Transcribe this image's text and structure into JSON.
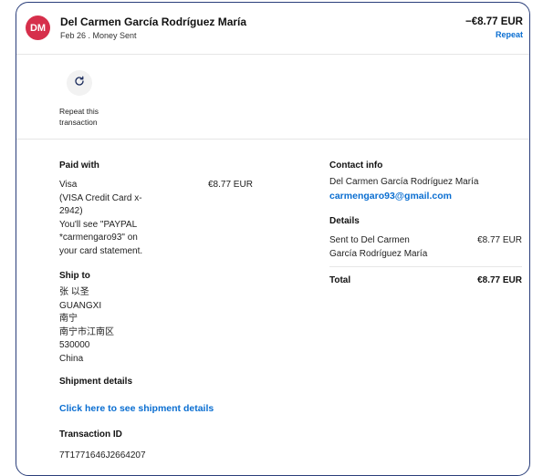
{
  "header": {
    "avatar_initials": "DM",
    "name": "Del Carmen García Rodríguez María",
    "subtitle": "Feb 26 . Money Sent",
    "amount": "−€8.77 EUR",
    "repeat_link": "Repeat"
  },
  "actions": {
    "repeat_label": "Repeat this transaction"
  },
  "paid_with": {
    "label": "Paid with",
    "lines": [
      "Visa",
      "(VISA Credit Card x-",
      "2942)",
      "You'll see \"PAYPAL",
      "*carmengaro93\" on",
      "your card statement."
    ],
    "amount": "€8.77 EUR"
  },
  "ship_to": {
    "label": "Ship to",
    "lines": [
      "张 以圣",
      "GUANGXI",
      "南宁",
      "南宁市江南区",
      "530000",
      "China"
    ]
  },
  "shipment": {
    "label": "Shipment details",
    "link": "Click here to see shipment details"
  },
  "transaction": {
    "label": "Transaction ID",
    "id": "7T1771646J2664207"
  },
  "contact": {
    "label": "Contact info",
    "name": "Del Carmen García Rodríguez María",
    "email": "carmengaro93@gmail.com"
  },
  "details": {
    "label": "Details",
    "sent_to_lines": [
      "Sent to Del Carmen",
      "García Rodríguez María"
    ],
    "sent_amount": "€8.77 EUR",
    "total_label": "Total",
    "total_amount": "€8.77 EUR"
  },
  "colors": {
    "avatar": "#d62f4b",
    "link": "#0a6ed1",
    "border": "#2a3e7a"
  }
}
